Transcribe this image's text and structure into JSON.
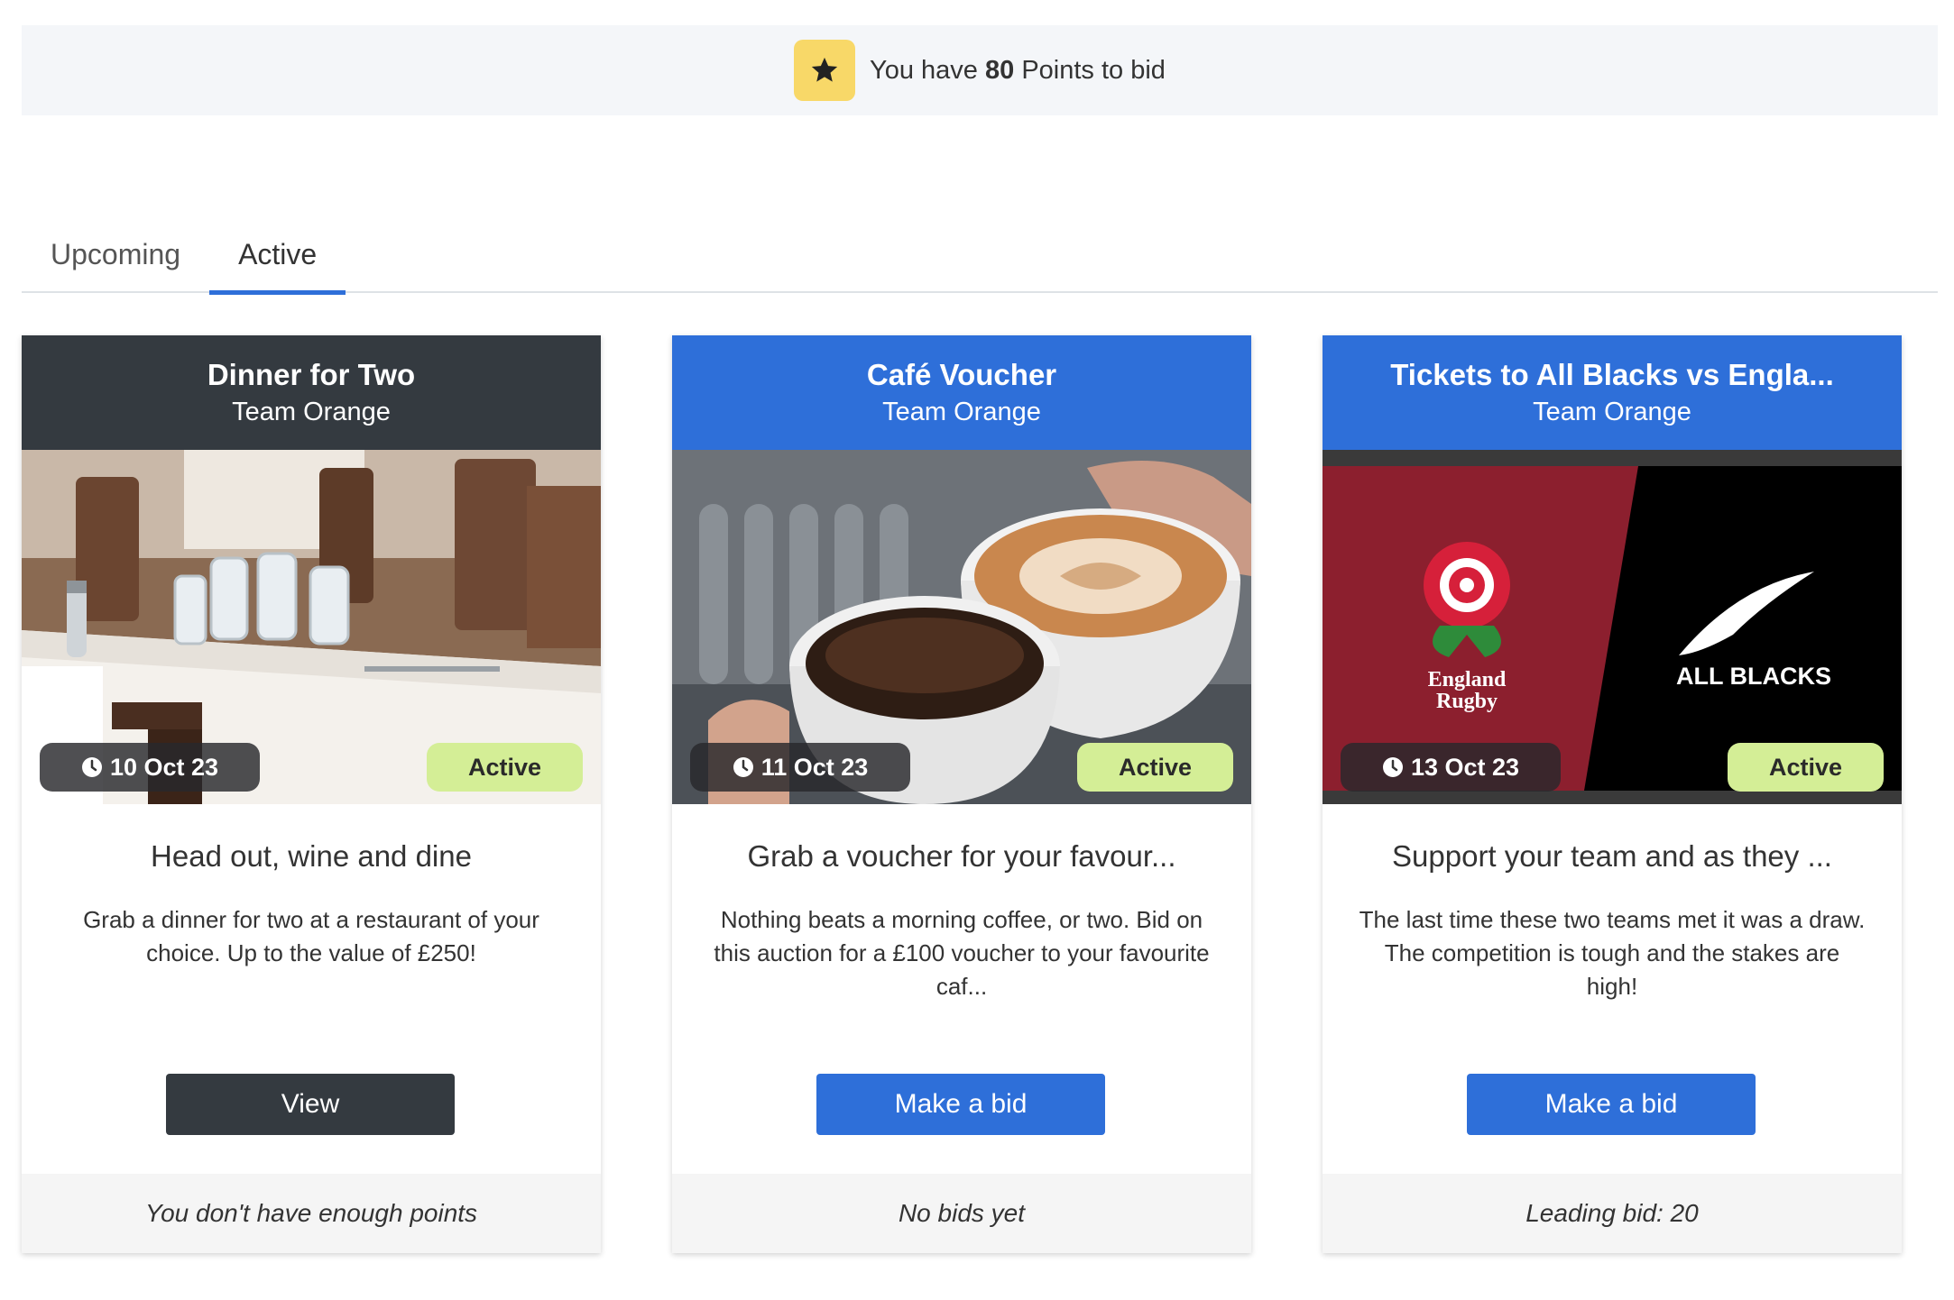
{
  "points_bar": {
    "icon": "star-icon",
    "prefix": "You have",
    "points": "80",
    "suffix": "Points to bid"
  },
  "tabs": [
    {
      "label": "Upcoming"
    },
    {
      "label": "Active"
    }
  ],
  "colors": {
    "primary": "#2e6fd9",
    "dark": "#343a40",
    "active_badge": "#d4ee96",
    "star_badge": "#f8d868"
  },
  "cards": [
    {
      "title": "Dinner for Two",
      "team": "Team Orange",
      "image": "restaurant-table-photo",
      "date": "10 Oct 23",
      "status": "Active",
      "subtitle": "Head out, wine and dine",
      "description": "Grab a dinner for two at a restaurant of your choice. Up to the value of £250!",
      "button": "View",
      "footer": "You don't have enough points"
    },
    {
      "title": "Café Voucher",
      "team": "Team Orange",
      "image": "coffee-cups-photo",
      "date": "11 Oct 23",
      "status": "Active",
      "subtitle": "Grab a voucher for your favour...",
      "description": "Nothing beats a morning coffee, or two. Bid on this auction for a £100 voucher to your favourite caf...",
      "button": "Make a bid",
      "footer": "No bids yet"
    },
    {
      "title": "Tickets to All Blacks vs Engla...",
      "team": "Team Orange",
      "image": "rugby-logos-graphic",
      "logo_text": {
        "england_1": "England",
        "england_2": "Rugby",
        "all_blacks": "ALL BLACKS"
      },
      "date": "13 Oct 23",
      "status": "Active",
      "subtitle": "Support your team and as they ...",
      "description": "The last time these two teams met it was a draw. The competition is tough and the stakes are high!",
      "button": "Make a bid",
      "footer": "Leading bid: 20"
    }
  ]
}
